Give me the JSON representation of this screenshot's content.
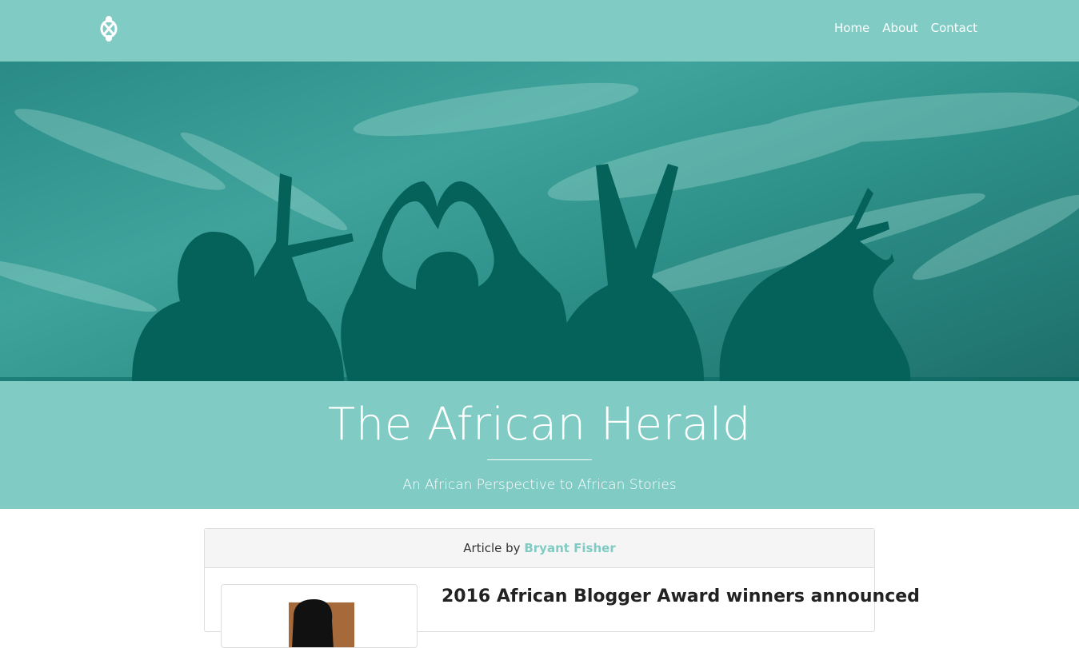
{
  "nav": {
    "logo": "adinkra-logo-icon",
    "links": [
      "Home",
      "About",
      "Contact"
    ]
  },
  "hero": {
    "image": "silhouettes-spelling-love-against-sky"
  },
  "header": {
    "title": "The African Herald",
    "subtitle": "An African Perspective to African Stories"
  },
  "article": {
    "byline_prefix": "Article by",
    "author": "Bryant Fisher",
    "title": "2016 African Blogger Award winners announced"
  },
  "colors": {
    "brand": "#80cbc4",
    "hero_overlay": "#2a8b86",
    "silhouette": "#04625b"
  }
}
